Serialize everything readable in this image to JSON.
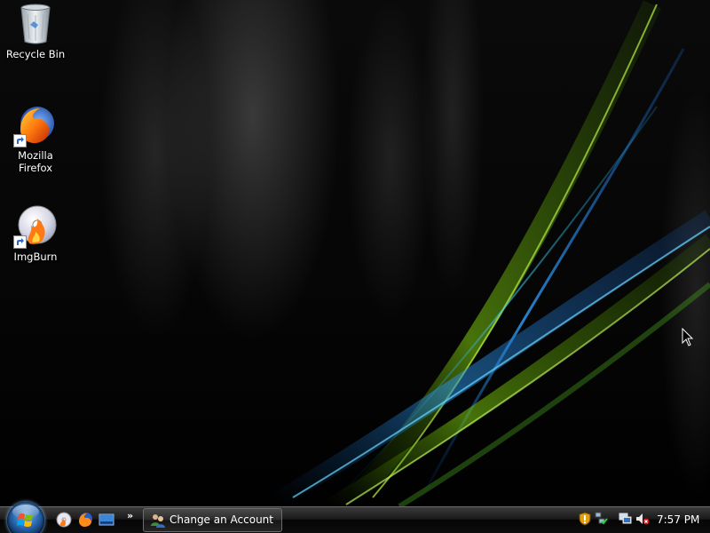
{
  "desktop": {
    "icons": [
      {
        "label": "Recycle Bin",
        "icon": "recycle-bin-icon"
      },
      {
        "label": "Mozilla Firefox",
        "icon": "firefox-icon"
      },
      {
        "label": "ImgBurn",
        "icon": "imgburn-icon"
      }
    ]
  },
  "taskbar": {
    "start_icon": "windows-start-orb-icon",
    "quick_launch": [
      {
        "icon": "imgburn-icon"
      },
      {
        "icon": "firefox-icon"
      },
      {
        "icon": "show-desktop-icon"
      }
    ],
    "quick_launch_overflow": "»",
    "active_window": {
      "label": "Change an Account",
      "icon": "user-accounts-icon"
    },
    "tray": {
      "icons": [
        "windows-security-shield-icon",
        "network-icon",
        "display-icon",
        "volume-muted-icon"
      ],
      "clock": "7:57 PM"
    }
  },
  "colors": {
    "taskbar": "#1b1b1b",
    "swoosh_green": "#8fd400",
    "swoosh_blue": "#2a8fe0"
  }
}
